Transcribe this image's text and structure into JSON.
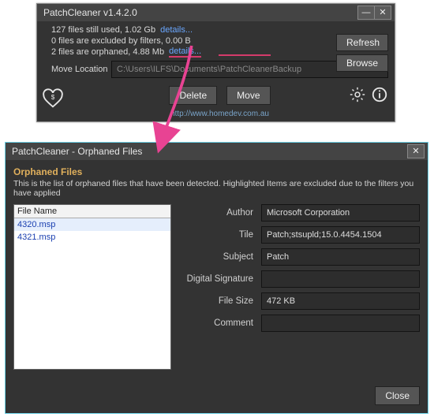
{
  "win1": {
    "title": "PatchCleaner v1.4.2.0",
    "stats": {
      "line1": "127 files still used, 1.02 Gb",
      "line1_details": "details...",
      "line2": "0 files are excluded by filters, 0.00 B",
      "line3": "2 files are orphaned, 4.88 Mb",
      "line3_details": "details..."
    },
    "move_label": "Move Location",
    "move_path": "C:\\Users\\ILFS\\Documents\\PatchCleanerBackup",
    "refresh": "Refresh",
    "browse": "Browse",
    "delete": "Delete",
    "move": "Move",
    "footer_url": "http://www.homedev.com.au"
  },
  "win2": {
    "title": "PatchCleaner - Orphaned Files",
    "section_title": "Orphaned Files",
    "section_desc": "This is the list of orphaned files that have been detected. Highlighted Items are excluded due to the filters you have applied",
    "list_header": "File Name",
    "files": {
      "f0": "4320.msp",
      "f1": "4321.msp"
    },
    "labels": {
      "author": "Author",
      "tile": "Tile",
      "subject": "Subject",
      "digsig": "Digital Signature",
      "filesize": "File Size",
      "comment": "Comment"
    },
    "vals": {
      "author": "Microsoft Corporation",
      "tile": "Patch;stsupld;15.0.4454.1504",
      "subject": "Patch",
      "digsig": "",
      "filesize": "472 KB",
      "comment": ""
    },
    "close": "Close"
  }
}
